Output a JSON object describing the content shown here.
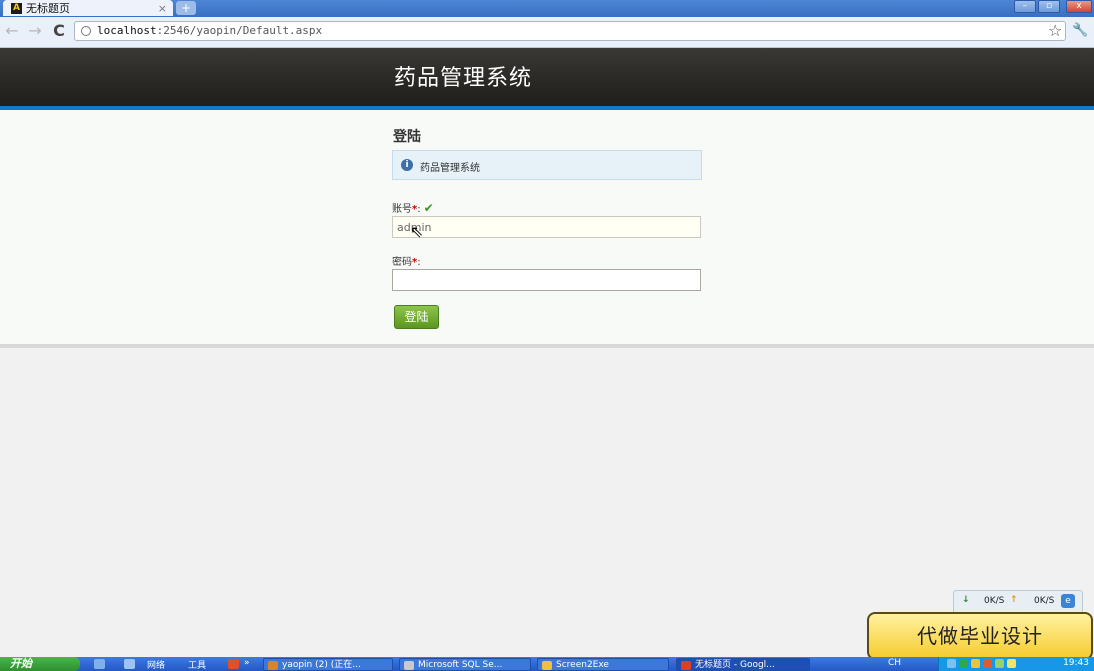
{
  "browser": {
    "tab_title": "无标题页",
    "tab_favicon_letter": "A",
    "tab_close": "×",
    "new_tab": "+",
    "url_host": "localhost",
    "url_rest": ":2546/yaopin/Default.aspx"
  },
  "site": {
    "title": "药品管理系统"
  },
  "login": {
    "heading": "登陆",
    "info_text": "药品管理系统",
    "account_label": "账号",
    "account_value": "admin",
    "password_label": "密码",
    "password_value": "",
    "required_mark": "*",
    "colon": ":",
    "submit_label": "登陆"
  },
  "speed": {
    "down": "0K/S",
    "up": "0K/S"
  },
  "advert": {
    "text": "代做毕业设计"
  },
  "taskbar": {
    "start_label": "开始",
    "quick_network": "网络",
    "quick_tools": "工具",
    "tasks": [
      {
        "label": "yaopin (2) (正在...",
        "color": "#d8842a"
      },
      {
        "label": "Microsoft SQL Se...",
        "color": "#c9c9c9"
      },
      {
        "label": "Screen2Exe",
        "color": "#f0c040"
      },
      {
        "label": "无标题页 - Googl...",
        "color": "#d9402a"
      }
    ],
    "lang": "CH",
    "clock": "19:43"
  },
  "icons": {
    "back": "back-arrow-icon",
    "forward": "forward-arrow-icon",
    "reload": "reload-icon",
    "star": "bookmark-star-icon",
    "wrench": "wrench-icon",
    "info": "info-icon",
    "check": "check-icon"
  },
  "colors": {
    "header_bg": "#2b2a27",
    "header_accent": "#1478c8",
    "button_green": "#6aa82c",
    "info_bg": "#e6f1f8",
    "taskbar_blue": "#2f66d0"
  }
}
